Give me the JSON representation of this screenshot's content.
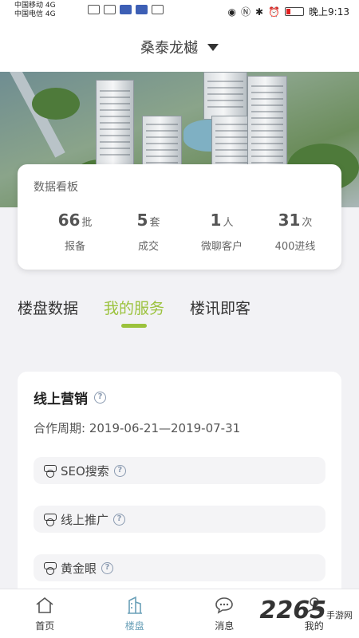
{
  "status_bar": {
    "carrier1": "中国移动",
    "carrier2": "中国电信",
    "net1": "4G",
    "net2": "4G",
    "time": "晚上9:13"
  },
  "header": {
    "title": "桑泰龙樾"
  },
  "board": {
    "title": "数据看板",
    "stats": [
      {
        "value": "66",
        "unit": "批",
        "label": "报备"
      },
      {
        "value": "5",
        "unit": "套",
        "label": "成交"
      },
      {
        "value": "1",
        "unit": "人",
        "label": "微聊客户"
      },
      {
        "value": "31",
        "unit": "次",
        "label": "400进线"
      }
    ]
  },
  "tabs": [
    {
      "label": "楼盘数据",
      "active": false
    },
    {
      "label": "我的服务",
      "active": true
    },
    {
      "label": "楼讯即客",
      "active": false
    }
  ],
  "service_card": {
    "title": "线上营销",
    "period": "合作周期: 2019-06-21—2019-07-31",
    "items": [
      {
        "label": "SEO搜索"
      },
      {
        "label": "线上推广"
      },
      {
        "label": "黄金眼"
      }
    ]
  },
  "bottom_nav": [
    {
      "label": "首页",
      "icon": "home-icon"
    },
    {
      "label": "楼盘",
      "icon": "building-icon"
    },
    {
      "label": "消息",
      "icon": "chat-icon"
    },
    {
      "label": "我的",
      "icon": "user-icon"
    }
  ],
  "watermark": {
    "text": "2265",
    "sub": "手游网"
  },
  "colors": {
    "accent": "#9bc23c",
    "nav_active": "#6aa0b8"
  }
}
